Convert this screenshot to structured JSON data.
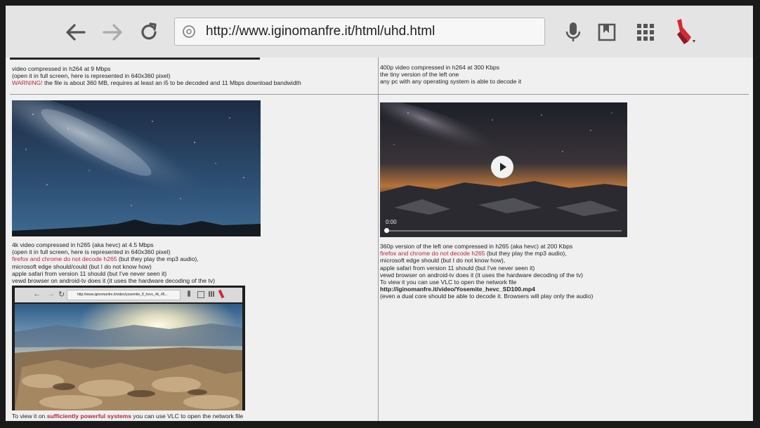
{
  "browser": {
    "url": "http://www.iginomanfre.it/html/uhd.html"
  },
  "icons": {
    "back": "arrow-left-icon",
    "forward": "arrow-right-icon",
    "reload": "reload-icon",
    "site": "globe-icon",
    "mic": "microphone-icon",
    "bookmarks": "bookmark-icon",
    "apps": "apps-grid-icon",
    "brand": "brand-logo-icon"
  },
  "left": {
    "top_block": {
      "line1": "video compressed in h264 at 9 Mbps",
      "line2": "(open it in full screen, here is represented in 640x360 pixel)",
      "warning_label": "WARNING!",
      "warning_text": " the file is about 360 MB, requires at least an i5 to be decoded and 11 Mbps download bandwidth"
    },
    "mid_block": {
      "line1": "4k video compressed in h265 (aka hevc) at 4.5 Mbps",
      "line2": "(open it in full screen, here is represented in 640x360 pixel)",
      "line3_red": "firefox and chrome do not decode h265",
      "line3_rest": " (but they play the mp3 audio),",
      "line4": "microsoft edge should/could (but I do not know how)",
      "line5": "apple safari from version 11 should (but I've never seen it)",
      "line6": "vewd browser on android-tv does it (it uses the hardware decoding of the tv)"
    },
    "bottom_block": {
      "line1_pre": "To view it on ",
      "line1_red": "sufficiently powerful systems",
      "line1_post": " you can use VLC to open the network file"
    },
    "inner_browser": {
      "url": "http://www.iginomanfre.it/video/yosemite_8_hevc_4k_45..."
    }
  },
  "right": {
    "top_block": {
      "line1": "400p video compressed in h264 at 300 Kbps",
      "line2": "the tiny version of the left one",
      "line3": "any pc with any operating system is able to decode it"
    },
    "player": {
      "time": "0:00"
    },
    "mid_block": {
      "line1": "360p version of the left one compressed in h265 (aka hevc) at 200 Kbps",
      "line2_red": "firefox and chrome do not decode h265",
      "line2_rest": " (but they play the mp3 audio),",
      "line3": "microsoft edge should (but I do not know how),",
      "line4": "apple safari from version 11 should (but I've never seen it)",
      "line5": "vewd browser on android-tv does it (it uses the hardware decoding of the tv)",
      "line6": "To view it you can use VLC to open the network file",
      "link": "http://iginomanfre.it/video/Yosemite_hevc_SD100.mp4",
      "line8": "(even a dual core should be able to decode it. Browsers will play only the audio)"
    }
  },
  "colors": {
    "warning": "#b02a3a",
    "toolbar_bg": "#e4e4e4",
    "page_bg": "#f0f0f0",
    "brand": "#d42a36"
  }
}
